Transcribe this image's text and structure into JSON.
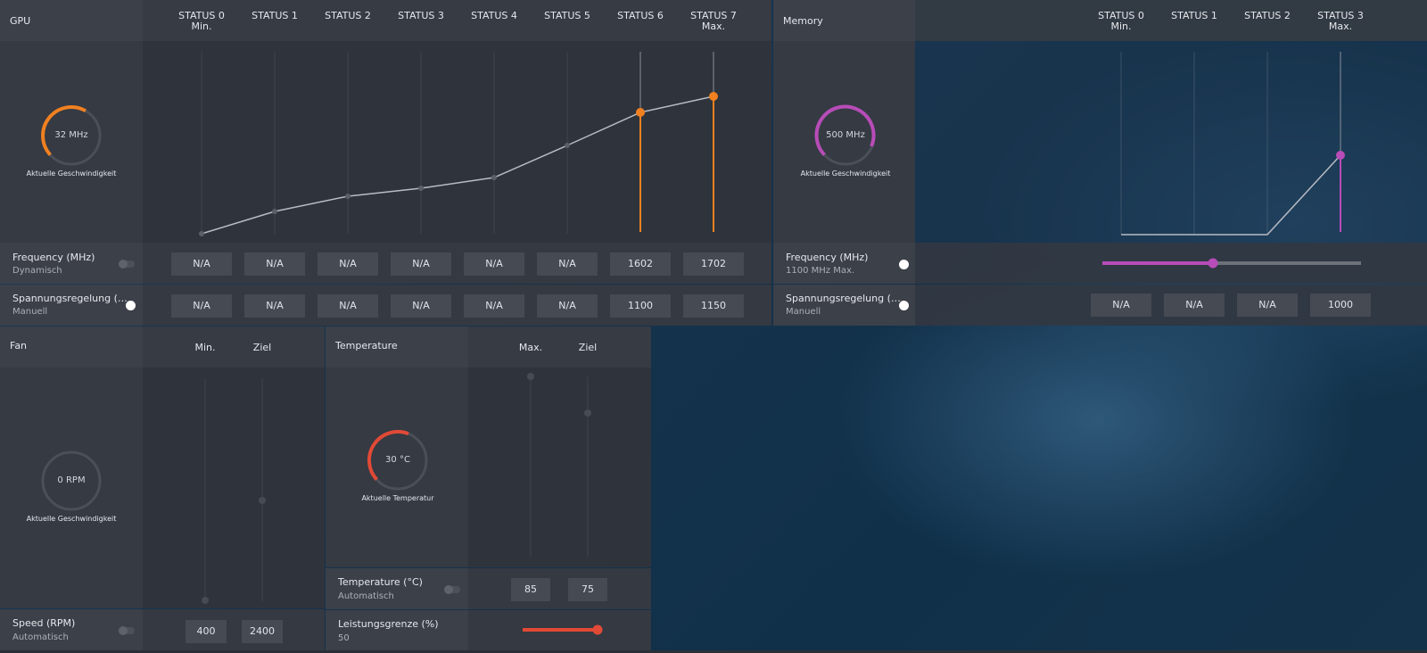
{
  "gpu": {
    "title": "GPU",
    "statuses": [
      {
        "label": "STATUS 0",
        "sub": "Min."
      },
      {
        "label": "STATUS 1",
        "sub": ""
      },
      {
        "label": "STATUS 2",
        "sub": ""
      },
      {
        "label": "STATUS 3",
        "sub": ""
      },
      {
        "label": "STATUS 4",
        "sub": ""
      },
      {
        "label": "STATUS 5",
        "sub": ""
      },
      {
        "label": "STATUS 6",
        "sub": ""
      },
      {
        "label": "STATUS 7",
        "sub": "Max."
      }
    ],
    "gauge": {
      "value": "32 MHz",
      "caption": "Aktuelle Geschwindigkeit",
      "color": "#f08020"
    },
    "frequency": {
      "label": "Frequency (MHz)",
      "mode": "Dynamisch",
      "values": [
        "N/A",
        "N/A",
        "N/A",
        "N/A",
        "N/A",
        "N/A",
        "1602",
        "1702"
      ]
    },
    "voltage": {
      "label": "Spannungsregelung (…",
      "mode": "Manuell",
      "values": [
        "N/A",
        "N/A",
        "N/A",
        "N/A",
        "N/A",
        "N/A",
        "1100",
        "1150"
      ]
    }
  },
  "memory": {
    "title": "Memory",
    "statuses": [
      {
        "label": "STATUS 0",
        "sub": "Min."
      },
      {
        "label": "STATUS 1",
        "sub": ""
      },
      {
        "label": "STATUS 2",
        "sub": ""
      },
      {
        "label": "STATUS 3",
        "sub": "Max."
      }
    ],
    "gauge": {
      "value": "500 MHz",
      "caption": "Aktuelle Geschwindigkeit",
      "color": "#b84cb8"
    },
    "frequency": {
      "label": "Frequency (MHz)",
      "mode": "1100 MHz Max.",
      "slider_fraction": 0.43
    },
    "voltage": {
      "label": "Spannungsregelung (…",
      "mode": "Manuell",
      "values": [
        "N/A",
        "N/A",
        "N/A",
        "1000"
      ]
    }
  },
  "fan": {
    "title": "Fan",
    "columns": [
      "Min.",
      "Ziel"
    ],
    "gauge": {
      "value": "0 RPM",
      "caption": "Aktuelle Geschwindigkeit"
    },
    "speed": {
      "label": "Speed (RPM)",
      "mode": "Automatisch",
      "values": [
        "400",
        "2400"
      ]
    }
  },
  "temperature": {
    "title": "Temperature",
    "columns": [
      "Max.",
      "Ziel"
    ],
    "gauge": {
      "value": "30 °C",
      "caption": "Aktuelle Temperatur",
      "color": "#e04a36"
    },
    "temp": {
      "label": "Temperature (°C)",
      "mode": "Automatisch",
      "values": [
        "85",
        "75"
      ]
    },
    "power": {
      "label": "Leistungsgrenze (%)",
      "value": "50",
      "slider_fraction": 1.0
    }
  }
}
